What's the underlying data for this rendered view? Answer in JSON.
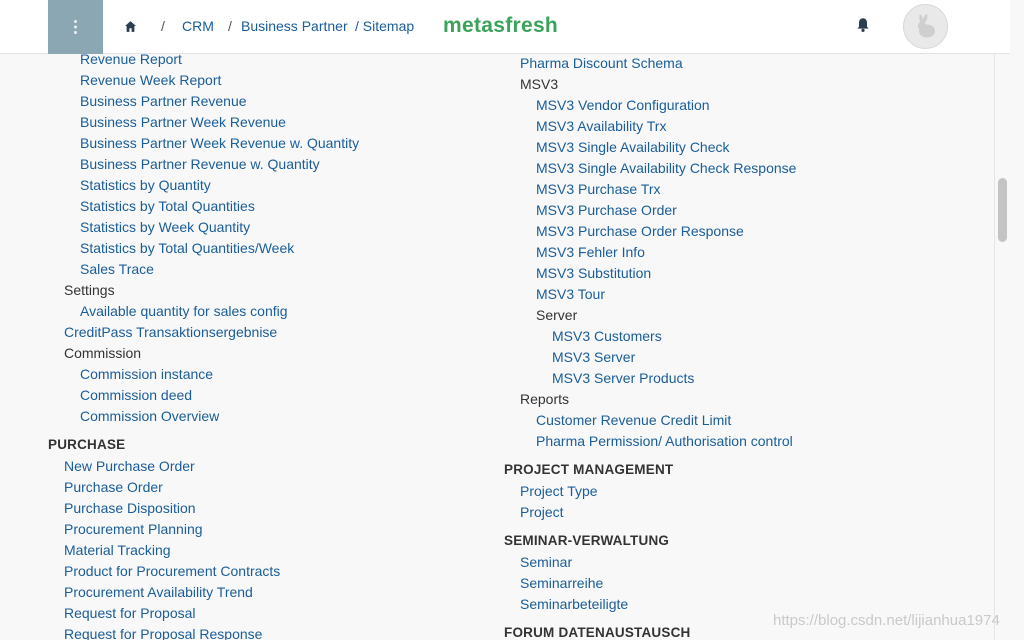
{
  "header": {
    "menu_icon": "kebab-menu-icon",
    "home_icon": "home-icon",
    "breadcrumb": [
      {
        "label": "/",
        "kind": "sep"
      },
      {
        "label": "CRM",
        "kind": "link"
      },
      {
        "label": "/",
        "kind": "sep"
      },
      {
        "label": "Business Partner",
        "kind": "link"
      },
      {
        "label": "/ Sitemap",
        "kind": "link"
      }
    ],
    "logo": "metasfresh",
    "bell_icon": "bell-icon",
    "avatar_icon": "rabbit-avatar-icon"
  },
  "left_column": [
    {
      "label": "Revenue Report",
      "type": "link",
      "level": 2
    },
    {
      "label": "Revenue Week Report",
      "type": "link",
      "level": 2
    },
    {
      "label": "Business Partner Revenue",
      "type": "link",
      "level": 2
    },
    {
      "label": "Business Partner Week Revenue",
      "type": "link",
      "level": 2
    },
    {
      "label": "Business Partner Week Revenue w. Quantity",
      "type": "link",
      "level": 2
    },
    {
      "label": "Business Partner Revenue w. Quantity",
      "type": "link",
      "level": 2
    },
    {
      "label": "Statistics by Quantity",
      "type": "link",
      "level": 2
    },
    {
      "label": "Statistics by Total Quantities",
      "type": "link",
      "level": 2
    },
    {
      "label": "Statistics by Week Quantity",
      "type": "link",
      "level": 2
    },
    {
      "label": "Statistics by Total Quantities/Week",
      "type": "link",
      "level": 2
    },
    {
      "label": "Sales Trace",
      "type": "link",
      "level": 2
    },
    {
      "label": "Settings",
      "type": "group",
      "level": 1
    },
    {
      "label": "Available quantity for sales config",
      "type": "link",
      "level": 2
    },
    {
      "label": "CreditPass Transaktionsergebnise",
      "type": "link",
      "level": 1
    },
    {
      "label": "Commission",
      "type": "group",
      "level": 1
    },
    {
      "label": "Commission instance",
      "type": "link",
      "level": 2
    },
    {
      "label": "Commission deed",
      "type": "link",
      "level": 2
    },
    {
      "label": "Commission Overview",
      "type": "link",
      "level": 2
    },
    {
      "label": "PURCHASE",
      "type": "section",
      "level": 0
    },
    {
      "label": "New Purchase Order",
      "type": "link",
      "level": 1
    },
    {
      "label": "Purchase Order",
      "type": "link",
      "level": 1
    },
    {
      "label": "Purchase Disposition",
      "type": "link",
      "level": 1
    },
    {
      "label": "Procurement Planning",
      "type": "link",
      "level": 1
    },
    {
      "label": "Material Tracking",
      "type": "link",
      "level": 1
    },
    {
      "label": "Product for Procurement Contracts",
      "type": "link",
      "level": 1
    },
    {
      "label": "Procurement Availability Trend",
      "type": "link",
      "level": 1
    },
    {
      "label": "Request for Proposal",
      "type": "link",
      "level": 1
    },
    {
      "label": "Request for Proposal Response",
      "type": "link",
      "level": 1
    }
  ],
  "right_column": [
    {
      "label": "Pharma Discount Schema",
      "type": "link",
      "level": 1
    },
    {
      "label": "MSV3",
      "type": "group",
      "level": 1
    },
    {
      "label": "MSV3 Vendor Configuration",
      "type": "link",
      "level": 2
    },
    {
      "label": "MSV3 Availability Trx",
      "type": "link",
      "level": 2
    },
    {
      "label": "MSV3 Single Availability Check",
      "type": "link",
      "level": 2
    },
    {
      "label": "MSV3 Single Availability Check Response",
      "type": "link",
      "level": 2
    },
    {
      "label": "MSV3 Purchase Trx",
      "type": "link",
      "level": 2
    },
    {
      "label": "MSV3 Purchase Order",
      "type": "link",
      "level": 2
    },
    {
      "label": "MSV3 Purchase Order Response",
      "type": "link",
      "level": 2
    },
    {
      "label": "MSV3 Fehler Info",
      "type": "link",
      "level": 2
    },
    {
      "label": "MSV3 Substitution",
      "type": "link",
      "level": 2
    },
    {
      "label": "MSV3 Tour",
      "type": "link",
      "level": 2
    },
    {
      "label": "Server",
      "type": "group",
      "level": 2
    },
    {
      "label": "MSV3 Customers",
      "type": "link",
      "level": 3
    },
    {
      "label": "MSV3 Server",
      "type": "link",
      "level": 3
    },
    {
      "label": "MSV3 Server Products",
      "type": "link",
      "level": 3
    },
    {
      "label": "Reports",
      "type": "group",
      "level": 1
    },
    {
      "label": "Customer Revenue Credit Limit",
      "type": "link",
      "level": 2
    },
    {
      "label": "Pharma Permission/ Authorisation control",
      "type": "link",
      "level": 2
    },
    {
      "label": "PROJECT MANAGEMENT",
      "type": "section",
      "level": 0
    },
    {
      "label": "Project Type",
      "type": "link",
      "level": 1
    },
    {
      "label": "Project",
      "type": "link",
      "level": 1
    },
    {
      "label": "SEMINAR-VERWALTUNG",
      "type": "section",
      "level": 0
    },
    {
      "label": "Seminar",
      "type": "link",
      "level": 1
    },
    {
      "label": "Seminarreihe",
      "type": "link",
      "level": 1
    },
    {
      "label": "Seminarbeteiligte",
      "type": "link",
      "level": 1
    },
    {
      "label": "FORUM DATENAUSTAUSCH",
      "type": "section",
      "level": 0
    }
  ],
  "watermark": "https://blog.csdn.net/lijianhua1974",
  "colors": {
    "link": "#1a5d99",
    "logo": "#3aa35a",
    "menu_button": "#8ba7b4"
  }
}
